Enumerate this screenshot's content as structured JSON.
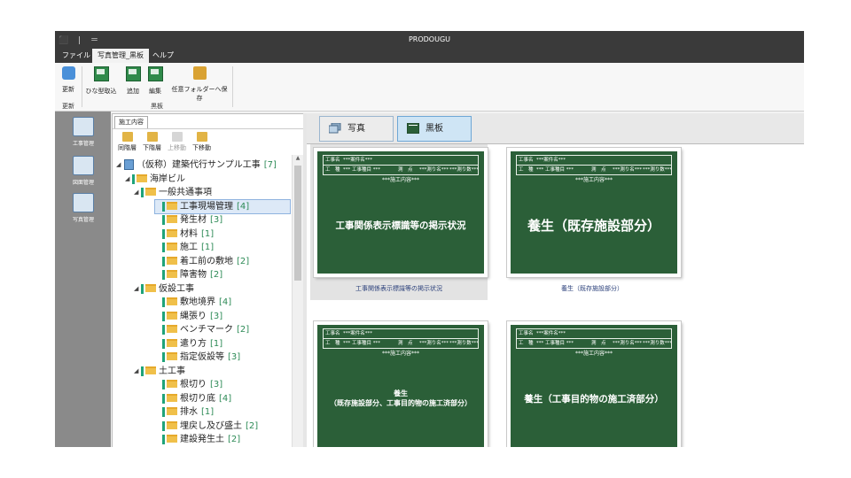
{
  "window": {
    "title": "PRODOUGU",
    "qat": "⬛ | ＝"
  },
  "menu": {
    "items": [
      "ファイル",
      "写真管理_黒板",
      "ヘルプ"
    ],
    "active_index": 1
  },
  "ribbon": {
    "groups": [
      {
        "label": "更新",
        "buttons": [
          {
            "label": "更新",
            "icon": "refresh-icon"
          }
        ]
      },
      {
        "label": "黒板",
        "buttons": [
          {
            "label": "ひな型取込",
            "icon": "template-import-icon"
          },
          {
            "label": "追加",
            "icon": "add-icon"
          },
          {
            "label": "編集",
            "icon": "edit-icon"
          },
          {
            "label": "任意フォルダーへ保存",
            "icon": "folder-save-icon"
          }
        ]
      }
    ]
  },
  "leftnav": {
    "items": [
      {
        "label": "工事管理",
        "icon": "project-icon"
      },
      {
        "label": "図面管理",
        "icon": "drawing-icon"
      },
      {
        "label": "写真管理",
        "icon": "photo-icon"
      }
    ]
  },
  "treepanel": {
    "tab": "施工内容",
    "tools": [
      {
        "label": "同階層",
        "icon": "same-level-icon",
        "enabled": true
      },
      {
        "label": "下階層",
        "icon": "child-level-icon",
        "enabled": true
      },
      {
        "label": "上移動",
        "icon": "move-up-icon",
        "enabled": false
      },
      {
        "label": "下移動",
        "icon": "move-down-icon",
        "enabled": true
      }
    ],
    "nodes": [
      {
        "level": 0,
        "label": "（仮称）建築代行サンプル工事",
        "count": "[7]",
        "expander": "◢",
        "kind": "root"
      },
      {
        "level": 1,
        "label": "海岸ビル",
        "count": "",
        "expander": "◢",
        "kind": "folder"
      },
      {
        "level": 2,
        "label": "一般共通事項",
        "count": "",
        "expander": "◢",
        "kind": "folder"
      },
      {
        "level": 3,
        "label": "工事現場管理",
        "count": "[4]",
        "expander": "",
        "kind": "folder",
        "selected": true
      },
      {
        "level": 3,
        "label": "発生材",
        "count": "[3]",
        "expander": "",
        "kind": "folder"
      },
      {
        "level": 3,
        "label": "材料",
        "count": "[1]",
        "expander": "",
        "kind": "folder"
      },
      {
        "level": 3,
        "label": "施工",
        "count": "[1]",
        "expander": "",
        "kind": "folder"
      },
      {
        "level": 3,
        "label": "着工前の敷地",
        "count": "[2]",
        "expander": "",
        "kind": "folder"
      },
      {
        "level": 3,
        "label": "障害物",
        "count": "[2]",
        "expander": "",
        "kind": "folder"
      },
      {
        "level": 2,
        "label": "仮設工事",
        "count": "",
        "expander": "◢",
        "kind": "folder"
      },
      {
        "level": 3,
        "label": "敷地境界",
        "count": "[4]",
        "expander": "",
        "kind": "folder"
      },
      {
        "level": 3,
        "label": "縄張り",
        "count": "[3]",
        "expander": "",
        "kind": "folder"
      },
      {
        "level": 3,
        "label": "ベンチマーク",
        "count": "[2]",
        "expander": "",
        "kind": "folder"
      },
      {
        "level": 3,
        "label": "遣り方",
        "count": "[1]",
        "expander": "",
        "kind": "folder"
      },
      {
        "level": 3,
        "label": "指定仮設等",
        "count": "[3]",
        "expander": "",
        "kind": "folder"
      },
      {
        "level": 2,
        "label": "土工事",
        "count": "",
        "expander": "◢",
        "kind": "folder"
      },
      {
        "level": 3,
        "label": "根切り",
        "count": "[3]",
        "expander": "",
        "kind": "folder"
      },
      {
        "level": 3,
        "label": "根切り底",
        "count": "[4]",
        "expander": "",
        "kind": "folder"
      },
      {
        "level": 3,
        "label": "排水",
        "count": "[1]",
        "expander": "",
        "kind": "folder"
      },
      {
        "level": 3,
        "label": "埋戻し及び盛土",
        "count": "[2]",
        "expander": "",
        "kind": "folder"
      },
      {
        "level": 3,
        "label": "建設発生土",
        "count": "[2]",
        "expander": "",
        "kind": "folder"
      }
    ]
  },
  "viewtabs": [
    {
      "label": "写真",
      "icon": "photo-stack-icon",
      "active": false
    },
    {
      "label": "黒板",
      "icon": "blackboard-icon",
      "active": true
    }
  ],
  "board_template": {
    "row1": [
      "工事名",
      "***案件名***"
    ],
    "row2": [
      "工　種",
      "*** 工事種目 ***",
      "測　点",
      "***測り名***",
      "***測り数***"
    ],
    "content_label": "***施工内容***"
  },
  "cards": [
    {
      "caption": "工事関係表示標識等の掲示状況",
      "label": "工事関係表示標識等の掲示状況",
      "selected": true
    },
    {
      "caption": "養生（既存施設部分）",
      "label": "養生（既存施設部分）",
      "selected": false
    },
    {
      "caption": "養生\n（既存施設部分、工事目的物の施工済部分）",
      "label": "",
      "selected": false
    },
    {
      "caption": "養生（工事目的物の施工済部分）",
      "label": "",
      "selected": false
    }
  ]
}
